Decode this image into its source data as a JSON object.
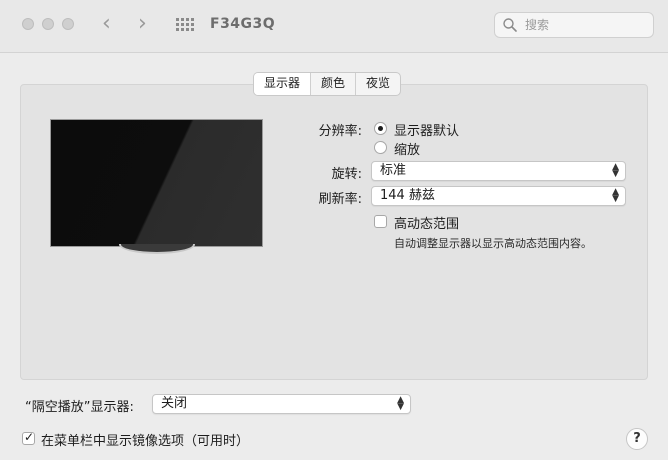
{
  "window": {
    "title": "F34G3Q"
  },
  "toolbar": {
    "back_icon": "chevron-left-icon",
    "forward_icon": "chevron-right-icon",
    "grid_icon": "grid-icon",
    "search_placeholder": "搜索"
  },
  "tabs": [
    {
      "label": "显示器",
      "active": true
    },
    {
      "label": "颜色",
      "active": false
    },
    {
      "label": "夜览",
      "active": false
    }
  ],
  "display": {
    "resolution_label": "分辨率:",
    "resolution_options": [
      {
        "label": "显示器默认",
        "selected": true
      },
      {
        "label": "缩放",
        "selected": false
      }
    ],
    "rotation_label": "旋转:",
    "rotation_value": "标准",
    "refresh_label": "刷新率:",
    "refresh_value": "144 赫兹",
    "hdr_label": "高动态范围",
    "hdr_checked": false,
    "hdr_note": "自动调整显示器以显示高动态范围内容。"
  },
  "airplay": {
    "label": "“隔空播放”显示器:",
    "value": "关闭"
  },
  "mirror_option": {
    "label": "在菜单栏中显示镜像选项（可用时）",
    "checked": true
  },
  "help": {
    "label": "?"
  },
  "colors": {
    "window_bg": "#ececec",
    "panel_bg": "#e3e3e3",
    "screen": "#0c0c0c"
  }
}
